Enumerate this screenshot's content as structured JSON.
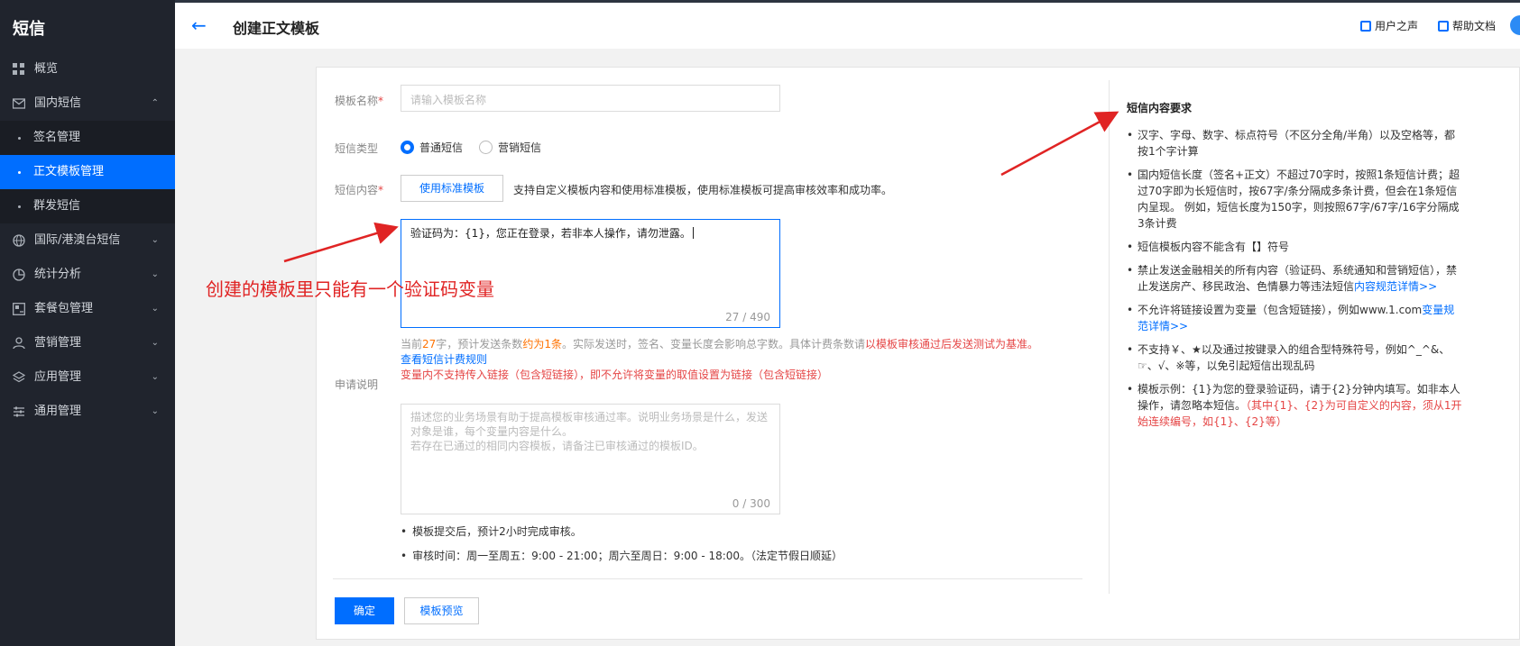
{
  "sidebar": {
    "brand": "短信",
    "items": [
      {
        "label": "概览",
        "icon": "grid-icon"
      },
      {
        "label": "国内短信",
        "icon": "mail-icon",
        "expanded": true
      },
      {
        "label": "国际/港澳台短信",
        "icon": "globe-icon"
      },
      {
        "label": "统计分析",
        "icon": "pie-chart-icon"
      },
      {
        "label": "套餐包管理",
        "icon": "package-icon"
      },
      {
        "label": "营销管理",
        "icon": "user-icon"
      },
      {
        "label": "应用管理",
        "icon": "layers-icon"
      },
      {
        "label": "通用管理",
        "icon": "sliders-icon"
      }
    ],
    "domestic_sub": [
      "签名管理",
      "正文模板管理",
      "群发短信"
    ],
    "active_sub": "正文模板管理"
  },
  "header": {
    "title": "创建正文模板",
    "user_voice": "用户之声",
    "help_docs": "帮助文档"
  },
  "form": {
    "name_label": "模板名称",
    "name_placeholder": "请输入模板名称",
    "type_label": "短信类型",
    "type_options": [
      "普通短信",
      "营销短信"
    ],
    "type_selected": "普通短信",
    "content_label": "短信内容",
    "use_standard_btn": "使用标准模板",
    "standard_tip": "支持自定义模板内容和使用标准模板，使用标准模板可提高审核效率和成功率。",
    "content_value": "验证码为：{1}，您正在登录，若非本人操作，请勿泄露。",
    "content_counter": "27 / 490",
    "hint_prefix": "当前",
    "hint_chars": "27",
    "hint_mid": "字，预计发送条数",
    "hint_count": "约为1条",
    "hint_rest": "。实际发送时，签名、变量长度会影响总字数。具体计费条数请",
    "hint_red": "以模板审核通过后发送测试为基准。",
    "billing_link": "查看短信计费规则",
    "link_warning": "变量内不支持传入链接（包含短链接），即不允许将变量的取值设置为链接（包含短链接）",
    "desc_label": "申请说明",
    "desc_placeholder": "描述您的业务场景有助于提高模板审核通过率。说明业务场景是什么，发送对象是谁，每个变量内容是什么。\n若存在已通过的相同内容模板，请备注已审核通过的模板ID。",
    "desc_counter": "0 / 300",
    "notes": [
      "模板提交后，预计2小时完成审核。",
      "审核时间：周一至周五：9:00 - 21:00；周六至周日：9:00 - 18:00。（法定节假日顺延）"
    ],
    "confirm_btn": "确定",
    "preview_btn": "模板预览"
  },
  "requirements": {
    "title": "短信内容要求",
    "rules": [
      {
        "text": "汉字、字母、数字、标点符号（不区分全角/半角）以及空格等，都按1个字计算"
      },
      {
        "text": "国内短信长度（签名+正文）不超过70字时，按照1条短信计费；超过70字即为长短信时，按67字/条分隔成多条计费，但会在1条短信内呈现。 例如，短信长度为150字，则按照67字/67字/16字分隔成3条计费"
      },
      {
        "text": "短信模板内容不能含有【】符号"
      },
      {
        "text": "禁止发送金融相关的所有内容（验证码、系统通知和营销短信），禁止发送房产、移民政治、色情暴力等违法短信",
        "link": "内容规范详情>>"
      },
      {
        "text": "不允许将链接设置为变量（包含短链接），例如www.1.com",
        "link": "变量规范详情>>"
      },
      {
        "text": "不支持￥、★以及通过按键录入的组合型特殊符号，例如^_^&、☞、√、※等，以免引起短信出现乱码"
      },
      {
        "text": "模板示例：{1}为您的登录验证码，请于{2}分钟内填写。如非本人操作，请忽略本短信。",
        "red": "（其中{1}、{2}为可自定义的内容，须从1开始连续编号，如{1}、{2}等）"
      }
    ]
  },
  "annotation": {
    "text": "创建的模板里只能有一个验证码变量",
    "color": "#e02424"
  },
  "colors": {
    "accent": "#006eff",
    "sidebar": "#20242d",
    "warning": "#e54545",
    "highlight": "#ff7200"
  }
}
